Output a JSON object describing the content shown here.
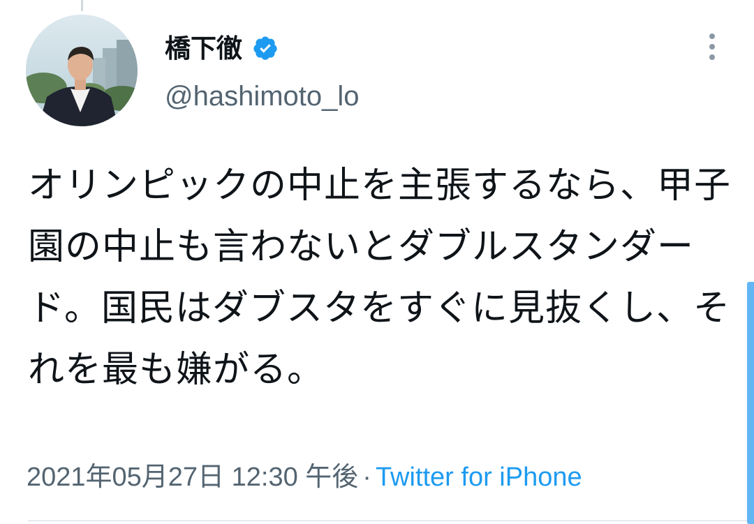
{
  "tweet": {
    "author": {
      "display_name": "橋下徹",
      "handle": "@hashimoto_lo",
      "verified": true,
      "verified_icon": "verified-badge-icon"
    },
    "text": "オリンピックの中止を主張するなら、甲子園の中止も言わないとダブルスタンダード。国民はダブスタをすぐに見抜くし、それを最も嫌がる。",
    "timestamp": "2021年05月27日 12:30 午後",
    "separator": "·",
    "source": "Twitter for iPhone",
    "more_icon": "more-vertical-icon"
  },
  "colors": {
    "text_primary": "#0f1419",
    "text_secondary": "#536471",
    "link": "#1d9bf0",
    "verified": "#1d9bf0"
  }
}
